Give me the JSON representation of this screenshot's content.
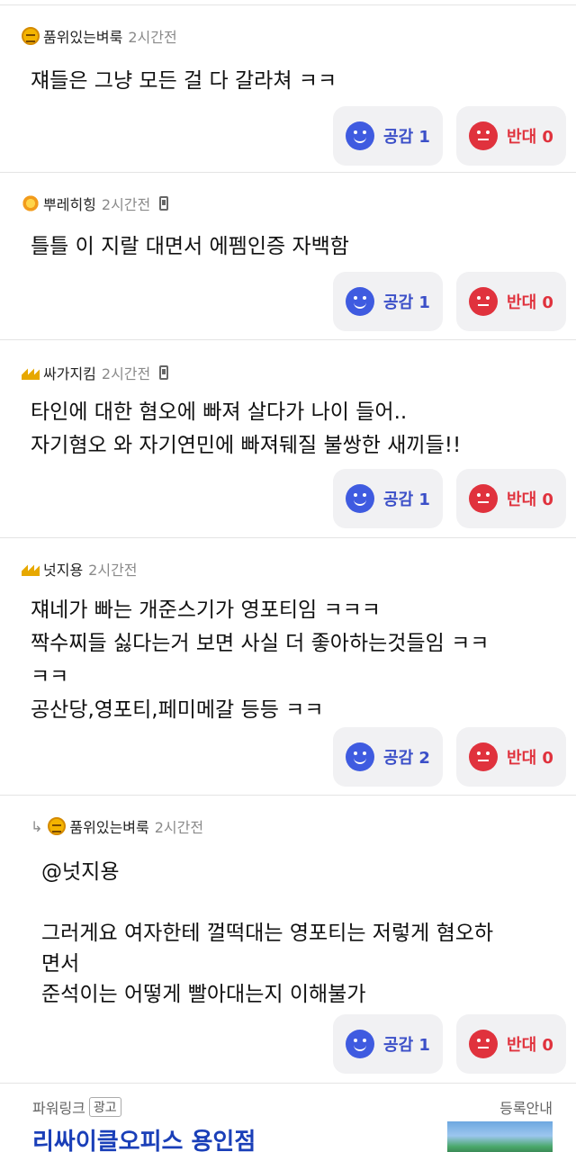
{
  "comments": [
    {
      "user": "품위있는벼룩",
      "time": "2시간전",
      "badge": "face",
      "text": "쟤들은 그냥 모든 걸 다 갈라쳐 ㅋㅋ",
      "like_label": "공감 1",
      "dislike_label": "반대 0"
    },
    {
      "user": "뿌레히힝",
      "time": "2시간전",
      "badge": "flower",
      "mobile": true,
      "text": "틀틀 이 지랄 대면서 에펨인증 자백함",
      "like_label": "공감 1",
      "dislike_label": "반대 0"
    },
    {
      "user": "싸가지킴",
      "time": "2시간전",
      "badge": "crown",
      "mobile": true,
      "text": "타인에 대한 혐오에 빠져 살다가 나이 들어..\n자기혐오 와 자기연민에 빠져뒈질 불쌍한 새끼들!!",
      "like_label": "공감 1",
      "dislike_label": "반대 0"
    },
    {
      "user": "넛지용",
      "time": "2시간전",
      "badge": "crown",
      "text": "쟤네가 빠는 개준스기가 영포티임 ㅋㅋㅋ\n짝수찌들 싫다는거 보면 사실 더 좋아하는것들임 ㅋㅋ\nㅋㅋ\n공산당,영포티,페미메갈 등등 ㅋㅋ",
      "like_label": "공감 2",
      "dislike_label": "반대 0"
    },
    {
      "user": "품위있는벼룩",
      "time": "2시간전",
      "badge": "face",
      "reply": true,
      "text": "@넛지용\n\n그러게요 여자한테 껄떡대는 영포티는 저렇게 혐오하\n면서\n준석이는 어떻게 빨아대는지 이해불가",
      "like_label": "공감 1",
      "dislike_label": "반대 0"
    }
  ],
  "ad": {
    "label": "파워링크",
    "tag": "광고",
    "info": "등록안내",
    "title": "리싸이클오피스 용인점"
  },
  "colors": {
    "like": "#3f5be0",
    "dislike": "#e0323d",
    "button_bg": "#f1f1f3",
    "ad_title": "#1a3fb8"
  }
}
